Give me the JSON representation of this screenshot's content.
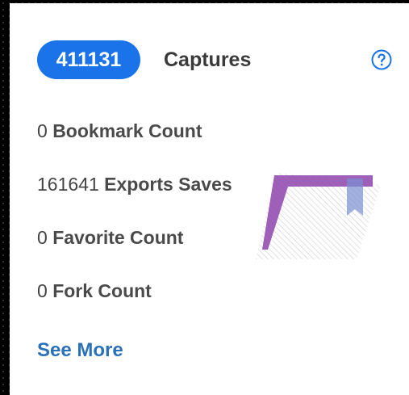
{
  "header": {
    "count": "411131",
    "label": "Captures"
  },
  "stats": [
    {
      "value": "0",
      "label": "Bookmark Count"
    },
    {
      "value": "161641",
      "label": "Exports Saves"
    },
    {
      "value": "0",
      "label": "Favorite Count"
    },
    {
      "value": "0",
      "label": "Fork Count"
    }
  ],
  "footer": {
    "see_more": "See More"
  },
  "colors": {
    "accent": "#1a73e8",
    "link": "#2b71b8",
    "decor_purple": "#8e44ad"
  },
  "icons": {
    "help": "question-circle-icon",
    "decor": "bookmark-ribbon-icon"
  }
}
